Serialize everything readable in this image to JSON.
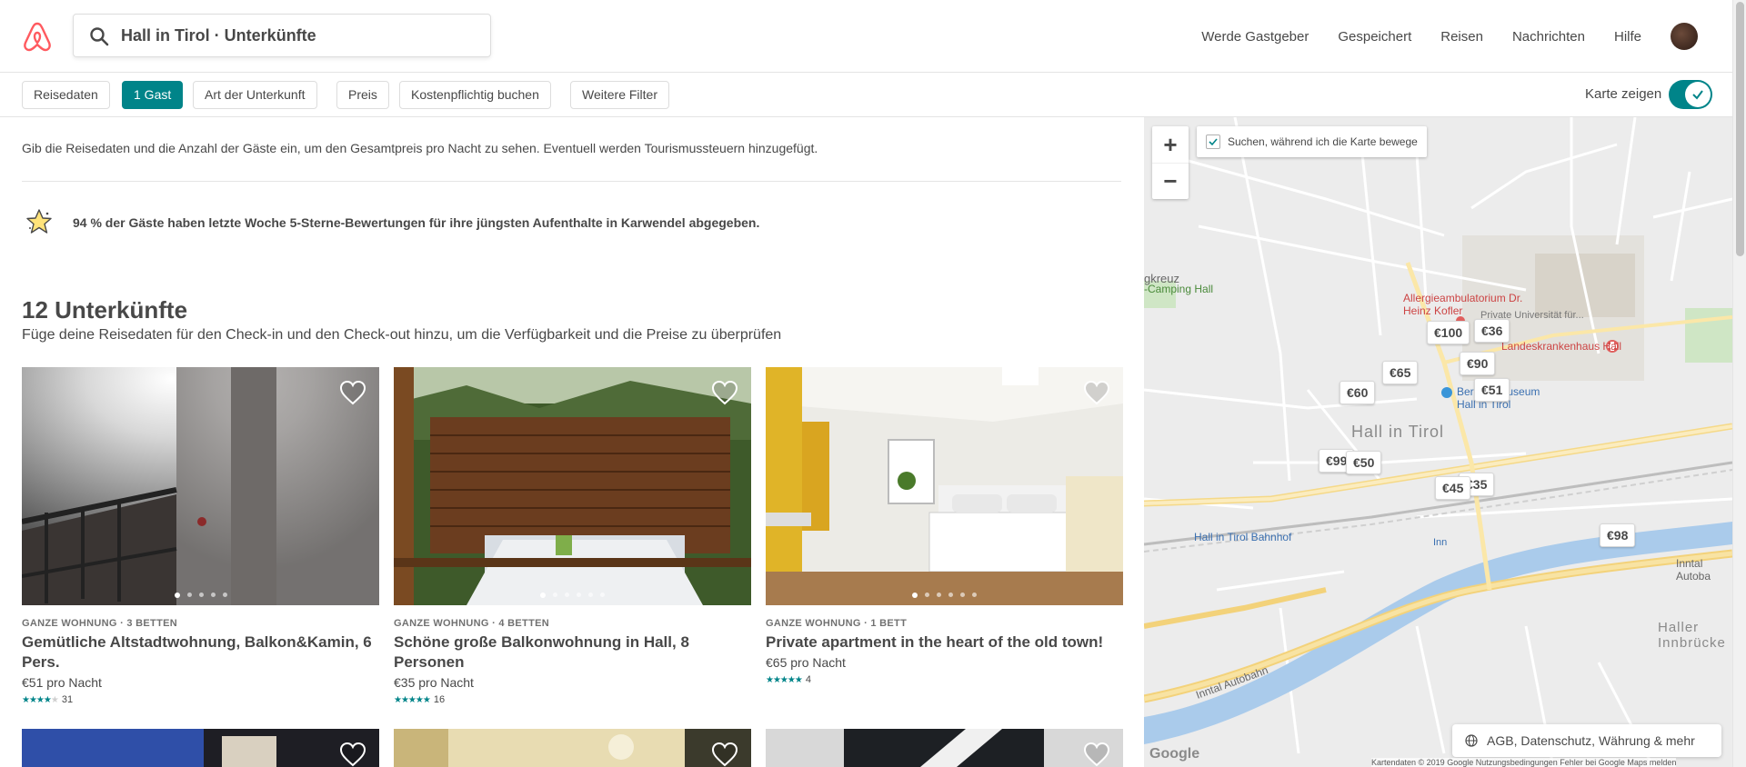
{
  "header": {
    "search_value": "Hall in Tirol · Unterkünfte",
    "nav": [
      "Werde Gastgeber",
      "Gespeichert",
      "Reisen",
      "Nachrichten",
      "Hilfe"
    ]
  },
  "filters": {
    "pills": [
      "Reisedaten",
      "1 Gast",
      "Art der Unterkunft",
      "Preis",
      "Kostenpflichtig buchen",
      "Weitere Filter"
    ],
    "active_index": 1,
    "map_toggle_label": "Karte zeigen",
    "map_toggle_on": true
  },
  "main": {
    "notice": "Gib die Reisedaten und die Anzahl der Gäste ein, um den Gesamtpreis pro Nacht zu sehen. Eventuell werden Tourismussteuern hinzugefügt.",
    "star_text": "94 % der Gäste haben letzte Woche 5-Sterne-Bewertungen für ihre jüngsten Aufenthalte in Karwendel abgegeben.",
    "count_title": "12 Unterkünfte",
    "count_sub": "Füge deine Reisedaten für den Check-in und den Check-out hinzu, um die Verfügbarkeit und die Preise zu überprüfen"
  },
  "listings": [
    {
      "type": "GANZE WOHNUNG · 3 BETTEN",
      "title": "Gemütliche Altstadtwohnung, Balkon&Kamin, 6 Pers.",
      "price": "€51 pro Nacht",
      "stars": 4,
      "reviews": "31"
    },
    {
      "type": "GANZE WOHNUNG · 4 BETTEN",
      "title": "Schöne große Balkonwohnung in Hall, 8 Personen",
      "price": "€35 pro Nacht",
      "stars": 5,
      "reviews": "16"
    },
    {
      "type": "GANZE WOHNUNG · 1 BETT",
      "title": "Private apartment in the heart of the old town!",
      "price": "€65 pro Nacht",
      "stars": 5,
      "reviews": "4"
    }
  ],
  "map": {
    "search_while_moving": "Suchen, während ich die Karte bewege",
    "pins": [
      "€100",
      "€36",
      "€90",
      "€65",
      "€60",
      "€51",
      "€99",
      "€50",
      "€45",
      "€35",
      "€98"
    ],
    "labels": {
      "town": "Hall in Tirol",
      "station": "Hall in Tirol Bahnhof",
      "allergy": "Allergieambulatorium Dr. Heinz Kofler",
      "uni": "Private Universität für...",
      "hospital": "Landeskrankenhaus Hall",
      "museum": "Bergbaumuseum Hall in Tirol",
      "camping": "-Camping Hall",
      "kreuz": "gkreuz",
      "haller": "Haller Innbrücke",
      "inntal": "Inntal Autobahn",
      "inntal_right": "Inntal Autoba",
      "inn": "Inn"
    },
    "footer_link": "AGB, Datenschutz, Währung & mehr",
    "google": "Google",
    "attribution": "Kartendaten © 2019 Google     Nutzungsbedingungen     Fehler bei Google Maps melden"
  }
}
